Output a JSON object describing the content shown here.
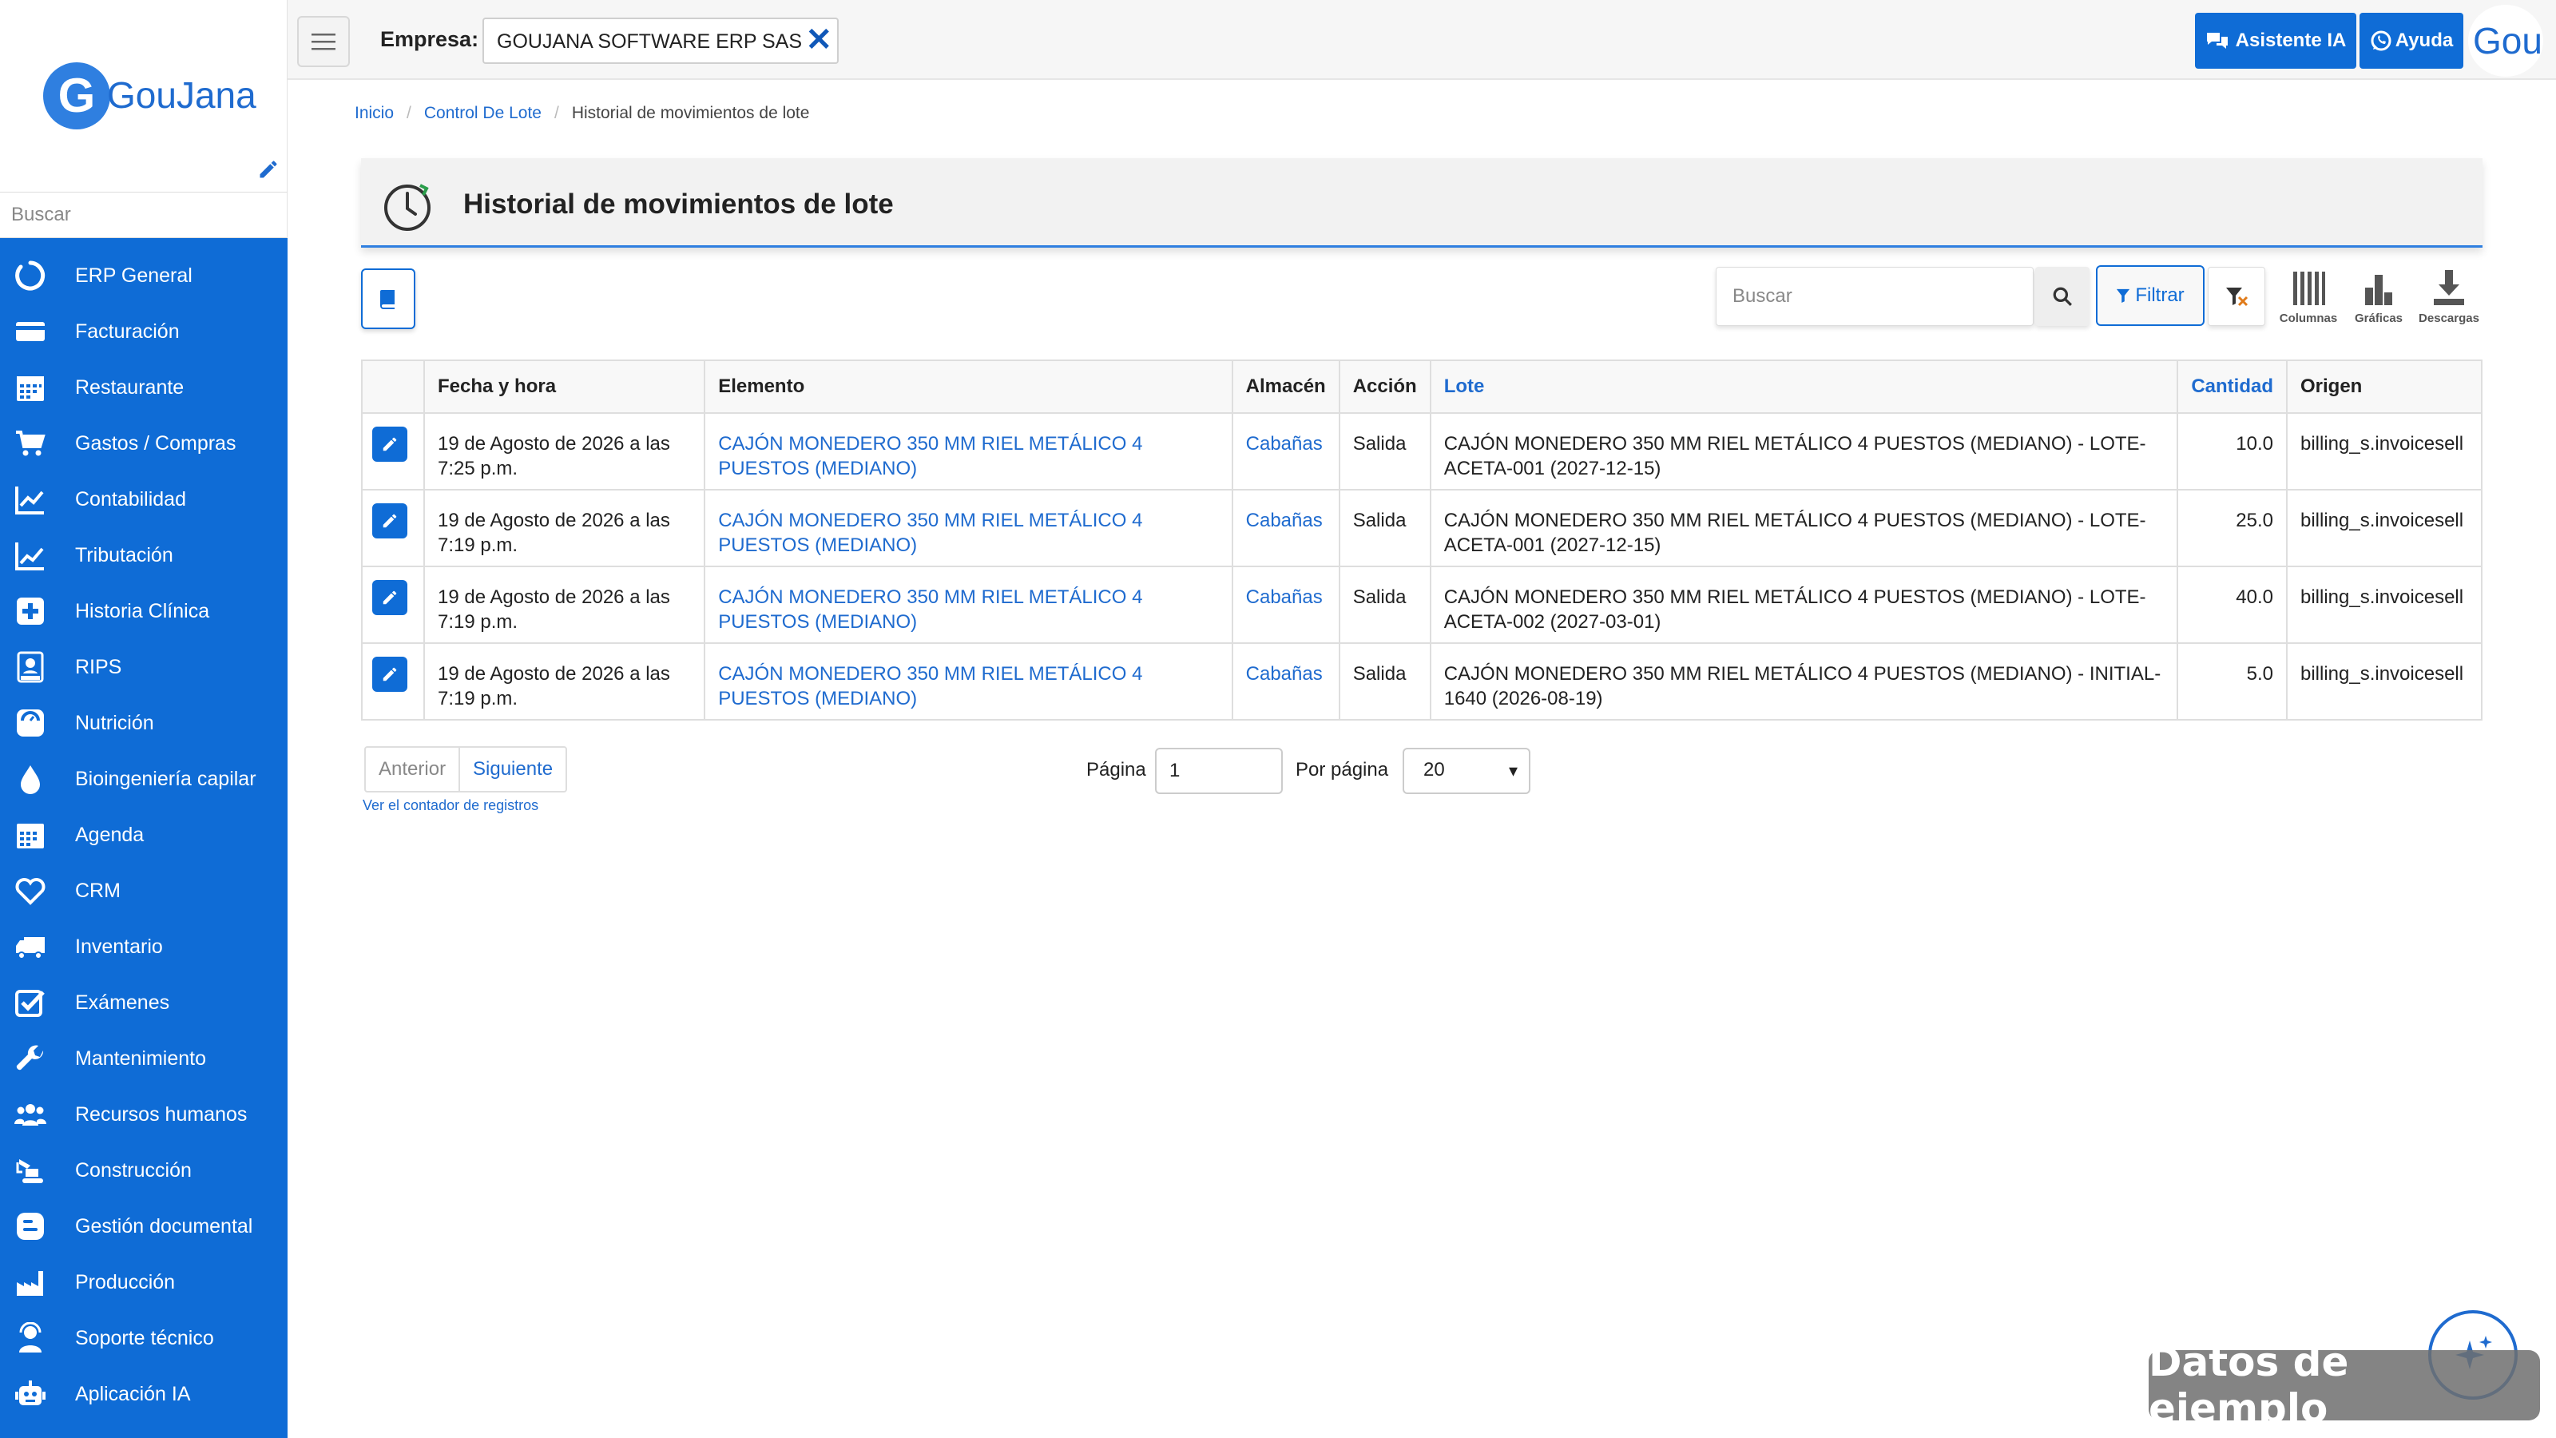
{
  "brand": {
    "logo_letter": "G",
    "logo_text": "GouJana"
  },
  "sidebar": {
    "search_placeholder": "Buscar",
    "items": [
      {
        "label": "ERP General",
        "icon": "circle-notch-icon"
      },
      {
        "label": "Facturación",
        "icon": "credit-card-icon"
      },
      {
        "label": "Restaurante",
        "icon": "calendar-grid-icon"
      },
      {
        "label": "Gastos / Compras",
        "icon": "shopping-cart-icon"
      },
      {
        "label": "Contabilidad",
        "icon": "line-chart-icon"
      },
      {
        "label": "Tributación",
        "icon": "trend-chart-icon"
      },
      {
        "label": "Historia Clínica",
        "icon": "medical-plus-icon"
      },
      {
        "label": "RIPS",
        "icon": "rips-document-icon"
      },
      {
        "label": "Nutrición",
        "icon": "scale-icon"
      },
      {
        "label": "Bioingeniería capilar",
        "icon": "droplet-icon"
      },
      {
        "label": "Agenda",
        "icon": "calendar-icon"
      },
      {
        "label": "CRM",
        "icon": "heart-icon"
      },
      {
        "label": "Inventario",
        "icon": "truck-icon"
      },
      {
        "label": "Exámenes",
        "icon": "checkbox-icon"
      },
      {
        "label": "Mantenimiento",
        "icon": "wrench-icon"
      },
      {
        "label": "Recursos humanos",
        "icon": "people-icon"
      },
      {
        "label": "Construcción",
        "icon": "excavator-icon"
      },
      {
        "label": "Gestión documental",
        "icon": "blog-icon"
      },
      {
        "label": "Producción",
        "icon": "factory-icon"
      },
      {
        "label": "Soporte técnico",
        "icon": "support-agent-icon"
      },
      {
        "label": "Aplicación IA",
        "icon": "robot-icon"
      }
    ]
  },
  "topbar": {
    "empresa_label": "Empresa:",
    "empresa_value": "GOUJANA SOFTWARE ERP SAS",
    "asistente_label": "Asistente IA",
    "ayuda_label": "Ayuda",
    "avatar_text": "Gou"
  },
  "breadcrumb": {
    "home": "Inicio",
    "section": "Control De Lote",
    "current": "Historial de movimientos de lote"
  },
  "page": {
    "title": "Historial de movimientos de lote"
  },
  "toolbar": {
    "search_placeholder": "Buscar",
    "filter_label": "Filtrar",
    "columns_label": "Columnas",
    "charts_label": "Gráficas",
    "downloads_label": "Descargas"
  },
  "table": {
    "headers": {
      "fecha": "Fecha y hora",
      "elemento": "Elemento",
      "almacen": "Almacén",
      "accion": "Acción",
      "lote": "Lote",
      "cantidad": "Cantidad",
      "origen": "Origen"
    },
    "rows": [
      {
        "fecha": "19 de Agosto de 2026 a las 7:25 p.m.",
        "elemento": "CAJÓN MONEDERO 350 MM RIEL METÁLICO 4 PUESTOS (MEDIANO)",
        "almacen": "Cabañas",
        "accion": "Salida",
        "lote": "CAJÓN MONEDERO 350 MM RIEL METÁLICO 4 PUESTOS (MEDIANO) - LOTE-ACETA-001 (2027-12-15)",
        "cantidad": "10.0",
        "origen": "billing_s.invoicesell"
      },
      {
        "fecha": "19 de Agosto de 2026 a las 7:19 p.m.",
        "elemento": "CAJÓN MONEDERO 350 MM RIEL METÁLICO 4 PUESTOS (MEDIANO)",
        "almacen": "Cabañas",
        "accion": "Salida",
        "lote": "CAJÓN MONEDERO 350 MM RIEL METÁLICO 4 PUESTOS (MEDIANO) - LOTE-ACETA-001 (2027-12-15)",
        "cantidad": "25.0",
        "origen": "billing_s.invoicesell"
      },
      {
        "fecha": "19 de Agosto de 2026 a las 7:19 p.m.",
        "elemento": "CAJÓN MONEDERO 350 MM RIEL METÁLICO 4 PUESTOS (MEDIANO)",
        "almacen": "Cabañas",
        "accion": "Salida",
        "lote": "CAJÓN MONEDERO 350 MM RIEL METÁLICO 4 PUESTOS (MEDIANO) - LOTE-ACETA-002 (2027-03-01)",
        "cantidad": "40.0",
        "origen": "billing_s.invoicesell"
      },
      {
        "fecha": "19 de Agosto de 2026 a las 7:19 p.m.",
        "elemento": "CAJÓN MONEDERO 350 MM RIEL METÁLICO 4 PUESTOS (MEDIANO)",
        "almacen": "Cabañas",
        "accion": "Salida",
        "lote": "CAJÓN MONEDERO 350 MM RIEL METÁLICO 4 PUESTOS (MEDIANO) - INITIAL-1640 (2026-08-19)",
        "cantidad": "5.0",
        "origen": "billing_s.invoicesell"
      }
    ]
  },
  "pagination": {
    "prev_label": "Anterior",
    "next_label": "Siguiente",
    "counter_link": "Ver el contador de registros",
    "page_label": "Página",
    "page_value": "1",
    "per_page_label": "Por página",
    "per_page_value": "20"
  },
  "badge": {
    "sample_label": "Datos de ejemplo"
  },
  "colors": {
    "primary": "#0f6cd6",
    "link": "#1f6bcf",
    "header_bg": "#f2f2f2"
  }
}
